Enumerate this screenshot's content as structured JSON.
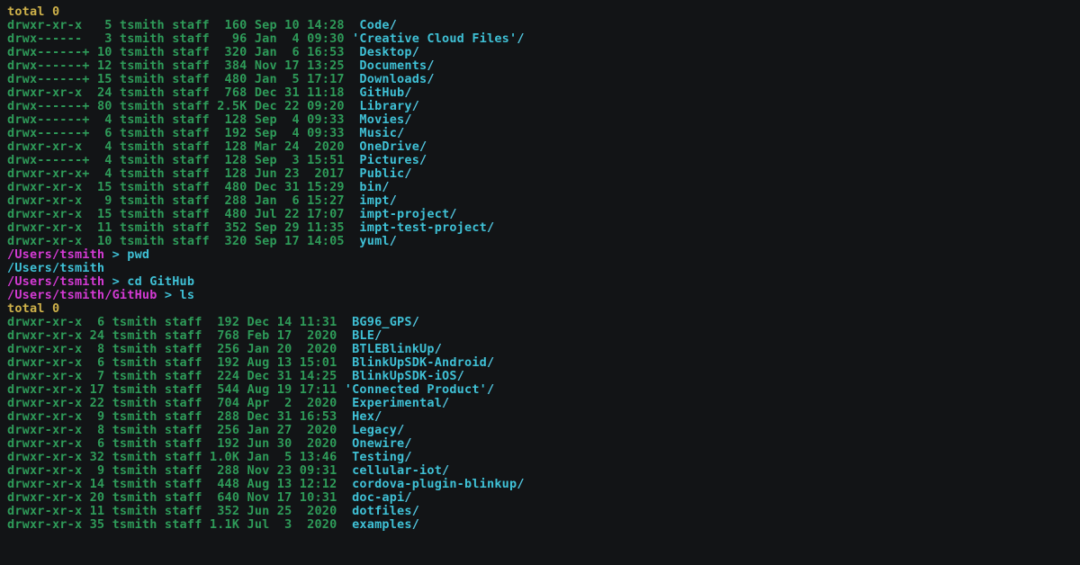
{
  "block1": {
    "total": "total 0",
    "rows": [
      {
        "perm": "drwxr-xr-x   ",
        "links": "5 ",
        "user": "tsmith ",
        "group": "staff  ",
        "size": "160 ",
        "date": "Sep 10 14:28  ",
        "name": "Code",
        "slash": "/"
      },
      {
        "perm": "drwx------   ",
        "links": "3 ",
        "user": "tsmith ",
        "group": "staff   ",
        "size": "96 ",
        "date": "Jan  4 09:30 ",
        "quote": true,
        "name": "Creative Cloud Files",
        "slash": "/"
      },
      {
        "perm": "drwx------+ ",
        "links": "10 ",
        "user": "tsmith ",
        "group": "staff  ",
        "size": "320 ",
        "date": "Jan  6 16:53  ",
        "name": "Desktop",
        "slash": "/"
      },
      {
        "perm": "drwx------+ ",
        "links": "12 ",
        "user": "tsmith ",
        "group": "staff  ",
        "size": "384 ",
        "date": "Nov 17 13:25  ",
        "name": "Documents",
        "slash": "/"
      },
      {
        "perm": "drwx------+ ",
        "links": "15 ",
        "user": "tsmith ",
        "group": "staff  ",
        "size": "480 ",
        "date": "Jan  5 17:17  ",
        "name": "Downloads",
        "slash": "/"
      },
      {
        "perm": "drwxr-xr-x  ",
        "links": "24 ",
        "user": "tsmith ",
        "group": "staff  ",
        "size": "768 ",
        "date": "Dec 31 11:18  ",
        "name": "GitHub",
        "slash": "/"
      },
      {
        "perm": "drwx------+ ",
        "links": "80 ",
        "user": "tsmith ",
        "group": "staff ",
        "size": "2.5K ",
        "date": "Dec 22 09:20  ",
        "name": "Library",
        "slash": "/"
      },
      {
        "perm": "drwx------+  ",
        "links": "4 ",
        "user": "tsmith ",
        "group": "staff  ",
        "size": "128 ",
        "date": "Sep  4 09:33  ",
        "name": "Movies",
        "slash": "/"
      },
      {
        "perm": "drwx------+  ",
        "links": "6 ",
        "user": "tsmith ",
        "group": "staff  ",
        "size": "192 ",
        "date": "Sep  4 09:33  ",
        "name": "Music",
        "slash": "/"
      },
      {
        "perm": "drwxr-xr-x   ",
        "links": "4 ",
        "user": "tsmith ",
        "group": "staff  ",
        "size": "128 ",
        "date": "Mar 24  2020  ",
        "name": "OneDrive",
        "slash": "/"
      },
      {
        "perm": "drwx------+  ",
        "links": "4 ",
        "user": "tsmith ",
        "group": "staff  ",
        "size": "128 ",
        "date": "Sep  3 15:51  ",
        "name": "Pictures",
        "slash": "/"
      },
      {
        "perm": "drwxr-xr-x+  ",
        "links": "4 ",
        "user": "tsmith ",
        "group": "staff  ",
        "size": "128 ",
        "date": "Jun 23  2017  ",
        "name": "Public",
        "slash": "/"
      },
      {
        "perm": "drwxr-xr-x  ",
        "links": "15 ",
        "user": "tsmith ",
        "group": "staff  ",
        "size": "480 ",
        "date": "Dec 31 15:29  ",
        "name": "bin",
        "slash": "/"
      },
      {
        "perm": "drwxr-xr-x   ",
        "links": "9 ",
        "user": "tsmith ",
        "group": "staff  ",
        "size": "288 ",
        "date": "Jan  6 15:27  ",
        "name": "impt",
        "slash": "/"
      },
      {
        "perm": "drwxr-xr-x  ",
        "links": "15 ",
        "user": "tsmith ",
        "group": "staff  ",
        "size": "480 ",
        "date": "Jul 22 17:07  ",
        "name": "impt-project",
        "slash": "/"
      },
      {
        "perm": "drwxr-xr-x  ",
        "links": "11 ",
        "user": "tsmith ",
        "group": "staff  ",
        "size": "352 ",
        "date": "Sep 29 11:35  ",
        "name": "impt-test-project",
        "slash": "/"
      },
      {
        "perm": "drwxr-xr-x  ",
        "links": "10 ",
        "user": "tsmith ",
        "group": "staff  ",
        "size": "320 ",
        "date": "Sep 17 14:05  ",
        "name": "yuml",
        "slash": "/"
      }
    ]
  },
  "prompts": [
    {
      "path": "/Users/tsmith ",
      "sep": "> ",
      "cmd": "pwd"
    },
    {
      "output": "/Users/tsmith"
    },
    {
      "path": "/Users/tsmith ",
      "sep": "> ",
      "cmd": "cd GitHub"
    },
    {
      "path": "/Users/tsmith/GitHub ",
      "sep": "> ",
      "cmd": "ls"
    }
  ],
  "block2": {
    "total": "total 0",
    "rows": [
      {
        "perm": "drwxr-xr-x  ",
        "links": "6 ",
        "user": "tsmith ",
        "group": "staff  ",
        "size": "192 ",
        "date": "Dec 14 11:31  ",
        "name": "BG96_GPS",
        "slash": "/"
      },
      {
        "perm": "drwxr-xr-x ",
        "links": "24 ",
        "user": "tsmith ",
        "group": "staff  ",
        "size": "768 ",
        "date": "Feb 17  2020  ",
        "name": "BLE",
        "slash": "/"
      },
      {
        "perm": "drwxr-xr-x  ",
        "links": "8 ",
        "user": "tsmith ",
        "group": "staff  ",
        "size": "256 ",
        "date": "Jan 20  2020  ",
        "name": "BTLEBlinkUp",
        "slash": "/"
      },
      {
        "perm": "drwxr-xr-x  ",
        "links": "6 ",
        "user": "tsmith ",
        "group": "staff  ",
        "size": "192 ",
        "date": "Aug 13 15:01  ",
        "name": "BlinkUpSDK-Android",
        "slash": "/"
      },
      {
        "perm": "drwxr-xr-x  ",
        "links": "7 ",
        "user": "tsmith ",
        "group": "staff  ",
        "size": "224 ",
        "date": "Dec 31 14:25  ",
        "name": "BlinkUpSDK-iOS",
        "slash": "/"
      },
      {
        "perm": "drwxr-xr-x ",
        "links": "17 ",
        "user": "tsmith ",
        "group": "staff  ",
        "size": "544 ",
        "date": "Aug 19 17:11 ",
        "quote": true,
        "name": "Connected Product",
        "slash": "/"
      },
      {
        "perm": "drwxr-xr-x ",
        "links": "22 ",
        "user": "tsmith ",
        "group": "staff  ",
        "size": "704 ",
        "date": "Apr  2  2020  ",
        "name": "Experimental",
        "slash": "/"
      },
      {
        "perm": "drwxr-xr-x  ",
        "links": "9 ",
        "user": "tsmith ",
        "group": "staff  ",
        "size": "288 ",
        "date": "Dec 31 16:53  ",
        "name": "Hex",
        "slash": "/"
      },
      {
        "perm": "drwxr-xr-x  ",
        "links": "8 ",
        "user": "tsmith ",
        "group": "staff  ",
        "size": "256 ",
        "date": "Jan 27  2020  ",
        "name": "Legacy",
        "slash": "/"
      },
      {
        "perm": "drwxr-xr-x  ",
        "links": "6 ",
        "user": "tsmith ",
        "group": "staff  ",
        "size": "192 ",
        "date": "Jun 30  2020  ",
        "name": "Onewire",
        "slash": "/"
      },
      {
        "perm": "drwxr-xr-x ",
        "links": "32 ",
        "user": "tsmith ",
        "group": "staff ",
        "size": "1.0K ",
        "date": "Jan  5 13:46  ",
        "name": "Testing",
        "slash": "/"
      },
      {
        "perm": "drwxr-xr-x  ",
        "links": "9 ",
        "user": "tsmith ",
        "group": "staff  ",
        "size": "288 ",
        "date": "Nov 23 09:31  ",
        "name": "cellular-iot",
        "slash": "/"
      },
      {
        "perm": "drwxr-xr-x ",
        "links": "14 ",
        "user": "tsmith ",
        "group": "staff  ",
        "size": "448 ",
        "date": "Aug 13 12:12  ",
        "name": "cordova-plugin-blinkup",
        "slash": "/"
      },
      {
        "perm": "drwxr-xr-x ",
        "links": "20 ",
        "user": "tsmith ",
        "group": "staff  ",
        "size": "640 ",
        "date": "Nov 17 10:31  ",
        "name": "doc-api",
        "slash": "/"
      },
      {
        "perm": "drwxr-xr-x ",
        "links": "11 ",
        "user": "tsmith ",
        "group": "staff  ",
        "size": "352 ",
        "date": "Jun 25  2020  ",
        "name": "dotfiles",
        "slash": "/"
      },
      {
        "perm": "drwxr-xr-x ",
        "links": "35 ",
        "user": "tsmith ",
        "group": "staff ",
        "size": "1.1K ",
        "date": "Jul  3  2020  ",
        "name": "examples",
        "slash": "/"
      }
    ]
  }
}
